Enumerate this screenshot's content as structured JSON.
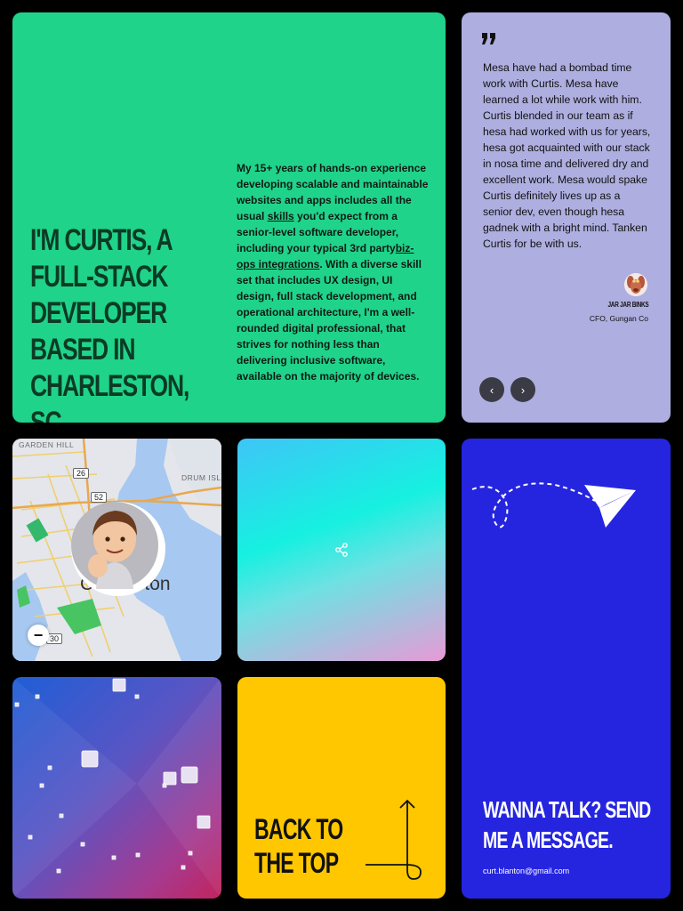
{
  "intro": {
    "headline": "I'm Curtis, a full-stack developer based in Charleston, SC.",
    "bio_part1": "My 15+ years of hands-on experience developing scalable and maintainable websites and apps includes all the usual ",
    "skills_link": "skills",
    "bio_part2": " you'd expect from a senior-level software developer, including your typical 3rd party",
    "bizops_link": "biz-ops integrations",
    "bio_part3": ". With a diverse skill set that includes UX design, UI design, full stack development, and operational architecture, I'm a well-rounded digital professional, that strives for nothing less than delivering inclusive software, available on the majority of devices."
  },
  "testimonial": {
    "quote": "Mesa have had a bombad time work with Curtis. Mesa have learned a lot while work with him. Curtis blended in our team as if hesa had worked with us for years, hesa got acquainted with our stack in nosa time and delivered dry and excellent work. Mesa would spake Curtis definitely lives up as a senior dev, even though hesa gadnek with a bright mind. Tanken Curtis for be with us.",
    "author_name": "Jar Jar Binks",
    "author_role": "CFO, Gungan Co",
    "prev_icon": "‹",
    "next_icon": "›"
  },
  "map": {
    "labels": {
      "garden_hill": "Garden Hill",
      "drum_island": "Drum Isl",
      "city": "Charleston"
    },
    "shields": [
      "26",
      "52",
      "30"
    ],
    "zoom_out": "−"
  },
  "contact": {
    "cta": "Wanna talk? Send me a message.",
    "email": "curt.blanton@gmail.com"
  },
  "backtop": {
    "label": "Back to the top"
  },
  "colors": {
    "intro_bg": "#20d38a",
    "testimonial_bg": "#aeaee0",
    "contact_bg": "#2525e0",
    "backtop_bg": "#ffc700"
  }
}
